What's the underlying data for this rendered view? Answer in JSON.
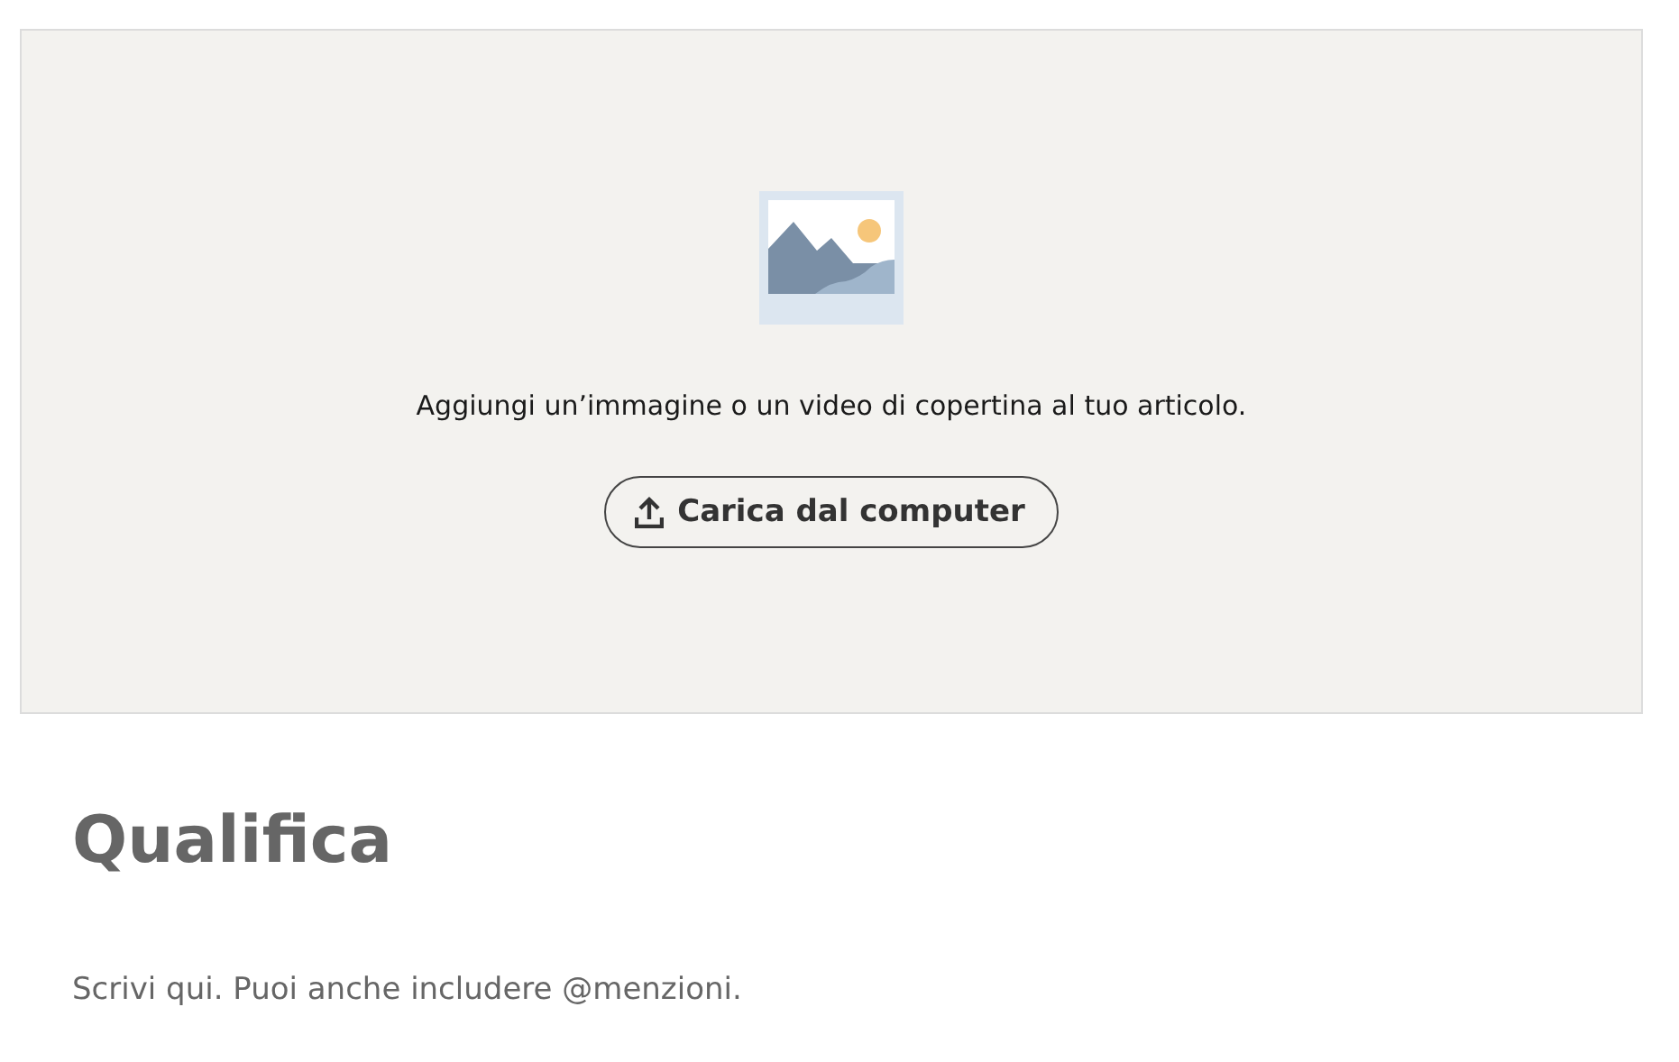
{
  "cover": {
    "prompt": "Aggiungi un’immagine o un video di copertina al tuo articolo.",
    "upload_button": "Carica dal computer"
  },
  "title_field": {
    "placeholder": "Qualifica"
  },
  "body_field": {
    "placeholder": "Scrivi qui. Puoi anche includere @menzioni."
  }
}
